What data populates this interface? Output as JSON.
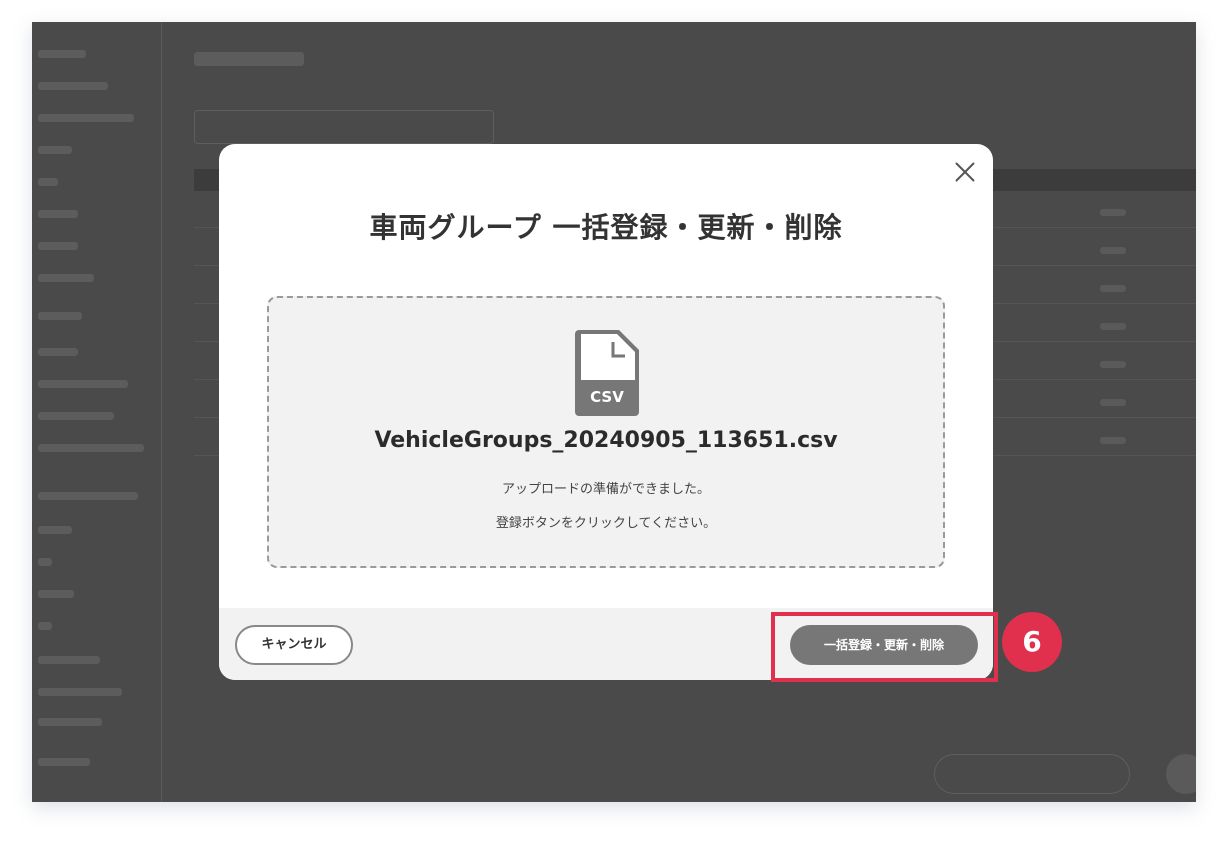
{
  "modal": {
    "title": "車両グループ 一括登録・更新・削除",
    "file_name": "VehicleGroups_20240905_113651.csv",
    "file_icon_label": "CSV",
    "message_line1": "アップロードの準備ができました。",
    "message_line2": "登録ボタンをクリックしてください。",
    "cancel_label": "キャンセル",
    "submit_label": "一括登録・更新・削除"
  },
  "annotation": {
    "step_number": "6",
    "highlight_color": "#e0304e"
  },
  "colors": {
    "overlay": "#4a4a4a",
    "submit_button": "#777777",
    "dropzone_bg": "#f2f2f2"
  },
  "icons": {
    "close": "close-icon",
    "file": "csv-file-icon"
  }
}
